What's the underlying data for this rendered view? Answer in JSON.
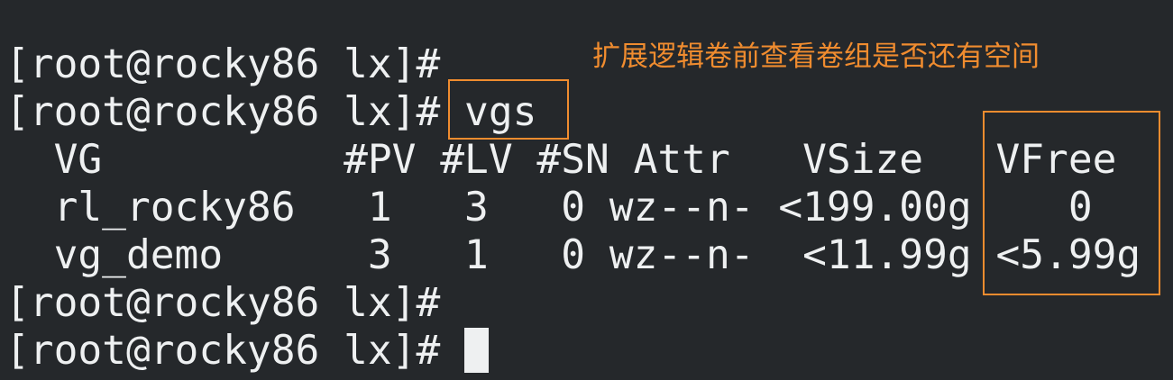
{
  "terminal": {
    "lines": [
      "[root@rocky86 lx]#",
      "[root@rocky86 lx]# vgs",
      "  VG          #PV #LV #SN Attr   VSize   VFree",
      "  rl_rocky86   1   3   0 wz--n- <199.00g    0",
      "  vg_demo      3   1   0 wz--n-  <11.99g <5.99g",
      "[root@rocky86 lx]#",
      "[root@rocky86 lx]# "
    ]
  },
  "annotation": {
    "text": "扩展逻辑卷前查看卷组是否还有空间"
  },
  "colors": {
    "background": "#25282b",
    "foreground": "#eef0f1",
    "highlight": "#f08c2f"
  }
}
